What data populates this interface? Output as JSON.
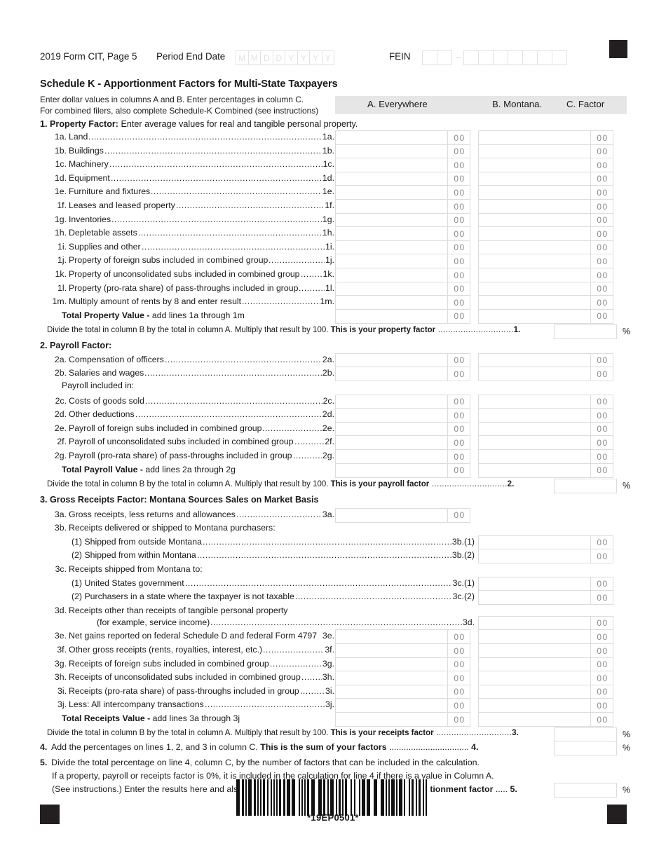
{
  "header": {
    "form_id": "2019 Form CIT, Page 5",
    "period_end_label": "Period End Date",
    "period_end_boxes": [
      "M",
      "M",
      "D",
      "D",
      "Y",
      "Y",
      "Y",
      "Y"
    ],
    "fein_label": "FEIN",
    "fein_prefix_boxes": [
      "",
      ""
    ],
    "fein_suffix_boxes": [
      "",
      "",
      "",
      "",
      "",
      "",
      ""
    ]
  },
  "schedule": {
    "title": "Schedule K - Apportionment Factors for Multi-State Taxpayers",
    "instruction_1": "Enter dollar values in columns A and B. Enter percentages in column C.",
    "instruction_2": "For combined filers, also complete Schedule-K Combined (see instructions)"
  },
  "columns": {
    "a": "A. Everywhere",
    "b": "B. Montana.",
    "c": "C. Factor"
  },
  "cents_placeholder": "00",
  "percent_sign": "%",
  "section1": {
    "heading_num": "1.",
    "heading_bold": "Property Factor:",
    "heading_rest": " Enter average values for real and tangible personal property.",
    "lines": [
      {
        "num": "1a.",
        "text": "Land",
        "tail": "1a."
      },
      {
        "num": "1b.",
        "text": "Buildings",
        "tail": "1b."
      },
      {
        "num": "1c.",
        "text": "Machinery",
        "tail": "1c."
      },
      {
        "num": "1d.",
        "text": "Equipment",
        "tail": "1d."
      },
      {
        "num": "1e.",
        "text": "Furniture and fixtures",
        "tail": "1e."
      },
      {
        "num": "1f.",
        "text": "Leases and leased property",
        "tail": "1f."
      },
      {
        "num": "1g.",
        "text": "Inventories",
        "tail": "1g."
      },
      {
        "num": "1h.",
        "text": "Depletable assets",
        "tail": "1h."
      },
      {
        "num": "1i.",
        "text": "Supplies and other",
        "tail": "1i."
      },
      {
        "num": "1j.",
        "text": "Property of foreign subs included in combined group",
        "tail": "1j."
      },
      {
        "num": "1k.",
        "text": "Property of unconsolidated subs included in combined group",
        "tail": "1k."
      },
      {
        "num": "1l.",
        "text": "Property (pro-rata share) of pass-throughs included in group",
        "tail": "1l."
      },
      {
        "num": "1m.",
        "text": "Multiply amount of rents by 8 and enter result",
        "tail": "1m."
      }
    ],
    "total_bold": "Total Property Value -",
    "total_rest": " add lines 1a through 1m",
    "divide_text": "Divide the total in column B by the total in column A. Multiply that result by 100. ",
    "divide_bold": "This is your property factor",
    "divide_line_num": "1."
  },
  "section2": {
    "heading_num": "2.",
    "heading_bold": "Payroll Factor:",
    "heading_rest": "",
    "lines": [
      {
        "num": "2a.",
        "text": "Compensation of officers",
        "tail": "2a."
      },
      {
        "num": "2b.",
        "text": "Salaries and wages",
        "tail": "2b."
      }
    ],
    "subheading": "Payroll included in:",
    "lines2": [
      {
        "num": "2c.",
        "text": "Costs of goods sold",
        "tail": "2c."
      },
      {
        "num": "2d.",
        "text": "Other deductions",
        "tail": "2d."
      },
      {
        "num": "2e.",
        "text": "Payroll of foreign subs included in combined group",
        "tail": "2e."
      },
      {
        "num": "2f.",
        "text": "Payroll of unconsolidated subs included in combined group",
        "tail": "2f."
      },
      {
        "num": "2g.",
        "text": "Payroll (pro-rata share) of pass-throughs included in group",
        "tail": "2g."
      }
    ],
    "total_bold": "Total Payroll Value -",
    "total_rest": " add lines 2a through 2g",
    "divide_text": "Divide the total in column B by the total in column A. Multiply that result by 100. ",
    "divide_bold": "This is your payroll factor",
    "divide_line_num": "2."
  },
  "section3": {
    "heading_num": "3.",
    "heading_bold": "Gross Receipts Factor: Montana Sources Sales on Market Basis",
    "line_3a": {
      "num": "3a.",
      "text": "Gross receipts, less returns and allowances",
      "tail": "3a."
    },
    "line_3b_head": {
      "num": "3b.",
      "text": "Receipts delivered or shipped to Montana purchasers:"
    },
    "line_3b_1": {
      "text": "(1) Shipped from outside Montana",
      "tail": "3b.(1)"
    },
    "line_3b_2": {
      "text": "(2) Shipped from within Montana",
      "tail": "3b.(2)"
    },
    "line_3c_head": {
      "num": "3c.",
      "text": "Receipts shipped from Montana to:"
    },
    "line_3c_1": {
      "text": "(1) United States government",
      "tail": "3c.(1)"
    },
    "line_3c_2": {
      "text": "(2) Purchasers in a state where the taxpayer is not taxable",
      "tail": "3c.(2)"
    },
    "line_3d_head": {
      "num": "3d.",
      "text": "Receipts other than receipts of tangible personal property"
    },
    "line_3d_cont": {
      "text": "(for example, service income)",
      "tail": "3d."
    },
    "lines": [
      {
        "num": "3e.",
        "text": "Net gains reported on federal Schedule D and federal Form 4797",
        "tail": "3e.",
        "nodots": true
      },
      {
        "num": "3f.",
        "text": "Other gross receipts (rents, royalties, interest, etc.)",
        "tail": "3f."
      },
      {
        "num": "3g.",
        "text": "Receipts of foreign subs included in combined group",
        "tail": "3g."
      },
      {
        "num": "3h.",
        "text": "Receipts of unconsolidated subs included in combined group",
        "tail": "3h."
      },
      {
        "num": "3i.",
        "text": "Receipts (pro-rata share) of pass-throughs included in group",
        "tail": "3i."
      },
      {
        "num": "3j.",
        "text": "Less: All intercompany transactions",
        "tail": "3j."
      }
    ],
    "total_bold": "Total Receipts Value -",
    "total_rest": " add lines 3a through 3j",
    "divide_text": "Divide the total in column B by the total in column A. Multiply that result by 100. ",
    "divide_bold": "This is your receipts factor",
    "divide_line_num": "3."
  },
  "line4": {
    "num": "4.",
    "text": "Add the percentages on lines 1, 2, and 3 in column C. ",
    "bold": "This is the sum of your factors",
    "line_num": "4."
  },
  "line5": {
    "num": "5.",
    "text_1": "Divide the total percentage on line 4, column C, by the number of factors that can be included in the calculation.",
    "text_2": "If a property, payroll or receipts factor is 0%, it is included in the calculation for line 4 if there is a value in Column A.",
    "text_3": "(See instructions.) Enter the results here and also on Form CIT, page 3, line 5. ",
    "bold_3": "This is your apportionment factor",
    "line_num": "5."
  },
  "footer": {
    "barcode_label": "*19EP0501*"
  }
}
